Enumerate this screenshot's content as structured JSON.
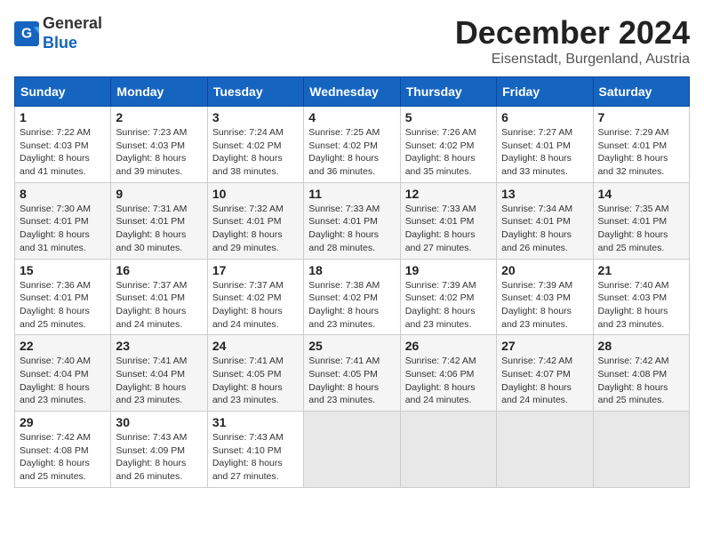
{
  "header": {
    "logo_line1": "General",
    "logo_line2": "Blue",
    "month_title": "December 2024",
    "location": "Eisenstadt, Burgenland, Austria"
  },
  "weekdays": [
    "Sunday",
    "Monday",
    "Tuesday",
    "Wednesday",
    "Thursday",
    "Friday",
    "Saturday"
  ],
  "weeks": [
    [
      {
        "day": "1",
        "sunrise": "7:22 AM",
        "sunset": "4:03 PM",
        "daylight": "8 hours and 41 minutes."
      },
      {
        "day": "2",
        "sunrise": "7:23 AM",
        "sunset": "4:03 PM",
        "daylight": "8 hours and 39 minutes."
      },
      {
        "day": "3",
        "sunrise": "7:24 AM",
        "sunset": "4:02 PM",
        "daylight": "8 hours and 38 minutes."
      },
      {
        "day": "4",
        "sunrise": "7:25 AM",
        "sunset": "4:02 PM",
        "daylight": "8 hours and 36 minutes."
      },
      {
        "day": "5",
        "sunrise": "7:26 AM",
        "sunset": "4:02 PM",
        "daylight": "8 hours and 35 minutes."
      },
      {
        "day": "6",
        "sunrise": "7:27 AM",
        "sunset": "4:01 PM",
        "daylight": "8 hours and 33 minutes."
      },
      {
        "day": "7",
        "sunrise": "7:29 AM",
        "sunset": "4:01 PM",
        "daylight": "8 hours and 32 minutes."
      }
    ],
    [
      {
        "day": "8",
        "sunrise": "7:30 AM",
        "sunset": "4:01 PM",
        "daylight": "8 hours and 31 minutes."
      },
      {
        "day": "9",
        "sunrise": "7:31 AM",
        "sunset": "4:01 PM",
        "daylight": "8 hours and 30 minutes."
      },
      {
        "day": "10",
        "sunrise": "7:32 AM",
        "sunset": "4:01 PM",
        "daylight": "8 hours and 29 minutes."
      },
      {
        "day": "11",
        "sunrise": "7:33 AM",
        "sunset": "4:01 PM",
        "daylight": "8 hours and 28 minutes."
      },
      {
        "day": "12",
        "sunrise": "7:33 AM",
        "sunset": "4:01 PM",
        "daylight": "8 hours and 27 minutes."
      },
      {
        "day": "13",
        "sunrise": "7:34 AM",
        "sunset": "4:01 PM",
        "daylight": "8 hours and 26 minutes."
      },
      {
        "day": "14",
        "sunrise": "7:35 AM",
        "sunset": "4:01 PM",
        "daylight": "8 hours and 25 minutes."
      }
    ],
    [
      {
        "day": "15",
        "sunrise": "7:36 AM",
        "sunset": "4:01 PM",
        "daylight": "8 hours and 25 minutes."
      },
      {
        "day": "16",
        "sunrise": "7:37 AM",
        "sunset": "4:01 PM",
        "daylight": "8 hours and 24 minutes."
      },
      {
        "day": "17",
        "sunrise": "7:37 AM",
        "sunset": "4:02 PM",
        "daylight": "8 hours and 24 minutes."
      },
      {
        "day": "18",
        "sunrise": "7:38 AM",
        "sunset": "4:02 PM",
        "daylight": "8 hours and 23 minutes."
      },
      {
        "day": "19",
        "sunrise": "7:39 AM",
        "sunset": "4:02 PM",
        "daylight": "8 hours and 23 minutes."
      },
      {
        "day": "20",
        "sunrise": "7:39 AM",
        "sunset": "4:03 PM",
        "daylight": "8 hours and 23 minutes."
      },
      {
        "day": "21",
        "sunrise": "7:40 AM",
        "sunset": "4:03 PM",
        "daylight": "8 hours and 23 minutes."
      }
    ],
    [
      {
        "day": "22",
        "sunrise": "7:40 AM",
        "sunset": "4:04 PM",
        "daylight": "8 hours and 23 minutes."
      },
      {
        "day": "23",
        "sunrise": "7:41 AM",
        "sunset": "4:04 PM",
        "daylight": "8 hours and 23 minutes."
      },
      {
        "day": "24",
        "sunrise": "7:41 AM",
        "sunset": "4:05 PM",
        "daylight": "8 hours and 23 minutes."
      },
      {
        "day": "25",
        "sunrise": "7:41 AM",
        "sunset": "4:05 PM",
        "daylight": "8 hours and 23 minutes."
      },
      {
        "day": "26",
        "sunrise": "7:42 AM",
        "sunset": "4:06 PM",
        "daylight": "8 hours and 24 minutes."
      },
      {
        "day": "27",
        "sunrise": "7:42 AM",
        "sunset": "4:07 PM",
        "daylight": "8 hours and 24 minutes."
      },
      {
        "day": "28",
        "sunrise": "7:42 AM",
        "sunset": "4:08 PM",
        "daylight": "8 hours and 25 minutes."
      }
    ],
    [
      {
        "day": "29",
        "sunrise": "7:42 AM",
        "sunset": "4:08 PM",
        "daylight": "8 hours and 25 minutes."
      },
      {
        "day": "30",
        "sunrise": "7:43 AM",
        "sunset": "4:09 PM",
        "daylight": "8 hours and 26 minutes."
      },
      {
        "day": "31",
        "sunrise": "7:43 AM",
        "sunset": "4:10 PM",
        "daylight": "8 hours and 27 minutes."
      },
      null,
      null,
      null,
      null
    ]
  ]
}
